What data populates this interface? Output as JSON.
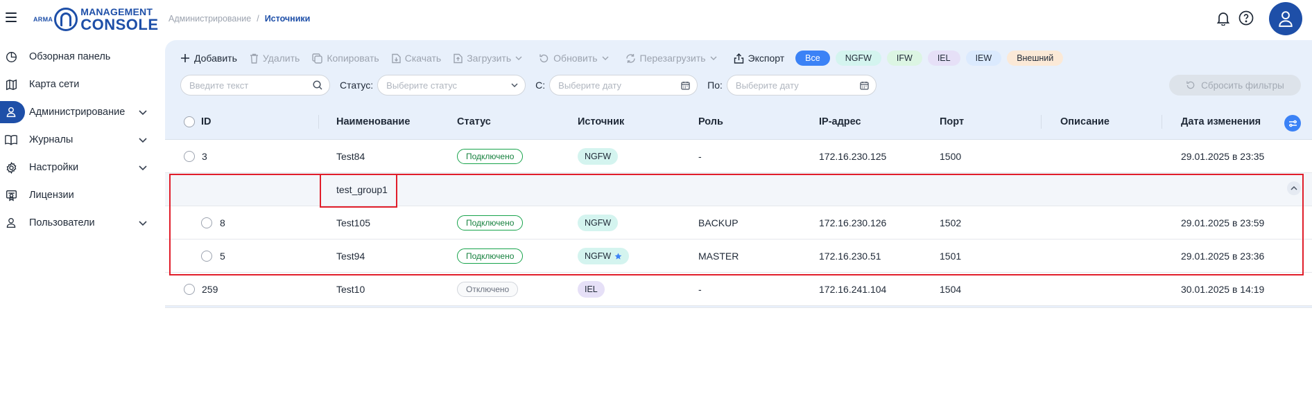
{
  "logo": {
    "prefix": "ARMA",
    "line1": "MANAGEMENT",
    "line2": "CONSOLE"
  },
  "sidebar": {
    "items": [
      {
        "label": "Обзорная панель",
        "icon": "pie-chart-icon",
        "active": false,
        "expandable": false
      },
      {
        "label": "Карта сети",
        "icon": "map-icon",
        "active": false,
        "expandable": false
      },
      {
        "label": "Администрирование",
        "icon": "user-icon",
        "active": true,
        "expandable": true
      },
      {
        "label": "Журналы",
        "icon": "book-icon",
        "active": false,
        "expandable": true
      },
      {
        "label": "Настройки",
        "icon": "gear-icon",
        "active": false,
        "expandable": true
      },
      {
        "label": "Лицензии",
        "icon": "certificate-icon",
        "active": false,
        "expandable": false
      },
      {
        "label": "Пользователи",
        "icon": "user-icon",
        "active": false,
        "expandable": true
      }
    ]
  },
  "breadcrumb": {
    "parent": "Администрирование",
    "separator": "/",
    "current": "Источники"
  },
  "toolbar": {
    "add": "Добавить",
    "delete": "Удалить",
    "copy": "Копировать",
    "download": "Скачать",
    "upload": "Загрузить",
    "update": "Обновить",
    "reboot": "Перезагрузить",
    "export": "Экспорт"
  },
  "chips": [
    {
      "label": "Все",
      "bg": "#3b82f6",
      "fg": "#ffffff"
    },
    {
      "label": "NGFW",
      "bg": "#d4f4ef",
      "fg": "#1f2937"
    },
    {
      "label": "IFW",
      "bg": "#dcf5e3",
      "fg": "#1f2937"
    },
    {
      "label": "IEL",
      "bg": "#e6e0f7",
      "fg": "#1f2937"
    },
    {
      "label": "IEW",
      "bg": "#dbeafe",
      "fg": "#1f2937"
    },
    {
      "label": "Внешний",
      "bg": "#fbe9d7",
      "fg": "#1f2937"
    }
  ],
  "filters": {
    "search_placeholder": "Введите текст",
    "status_label": "Статус:",
    "status_placeholder": "Выберите статус",
    "from_label": "С:",
    "from_placeholder": "Выберите дату",
    "to_label": "По:",
    "to_placeholder": "Выберите дату",
    "reset": "Сбросить фильтры"
  },
  "table": {
    "headers": {
      "id": "ID",
      "name": "Наименование",
      "status": "Статус",
      "source": "Источник",
      "role": "Роль",
      "ip": "IP-адрес",
      "port": "Порт",
      "description": "Описание",
      "date": "Дата изменения"
    },
    "rows": [
      {
        "type": "item",
        "id": "3",
        "name": "Test84",
        "status": "Подключено",
        "status_kind": "on",
        "source": "NGFW",
        "source_kind": "ngfw",
        "role": "-",
        "ip": "172.16.230.125",
        "port": "1500",
        "description": "",
        "date": "29.01.2025 в 23:35",
        "indent": false
      },
      {
        "type": "group",
        "name": "test_group1"
      },
      {
        "type": "item",
        "id": "8",
        "name": "Test105",
        "status": "Подключено",
        "status_kind": "on",
        "source": "NGFW",
        "source_kind": "ngfw",
        "role": "BACKUP",
        "ip": "172.16.230.126",
        "port": "1502",
        "description": "",
        "date": "29.01.2025 в 23:59",
        "indent": true
      },
      {
        "type": "item",
        "id": "5",
        "name": "Test94",
        "status": "Подключено",
        "status_kind": "on",
        "source": "NGFW",
        "source_kind": "ngfw",
        "star": true,
        "role": "MASTER",
        "ip": "172.16.230.51",
        "port": "1501",
        "description": "",
        "date": "29.01.2025 в 23:36",
        "indent": true
      },
      {
        "type": "item",
        "id": "259",
        "name": "Test10",
        "status": "Отключено",
        "status_kind": "off",
        "source": "IEL",
        "source_kind": "iel",
        "role": "-",
        "ip": "172.16.241.104",
        "port": "1504",
        "description": "",
        "date": "30.01.2025 в 14:19",
        "indent": false
      }
    ]
  },
  "colors": {
    "brand": "#1e4fa8",
    "accent": "#3b82f6",
    "highlight": "#e11d2a"
  }
}
